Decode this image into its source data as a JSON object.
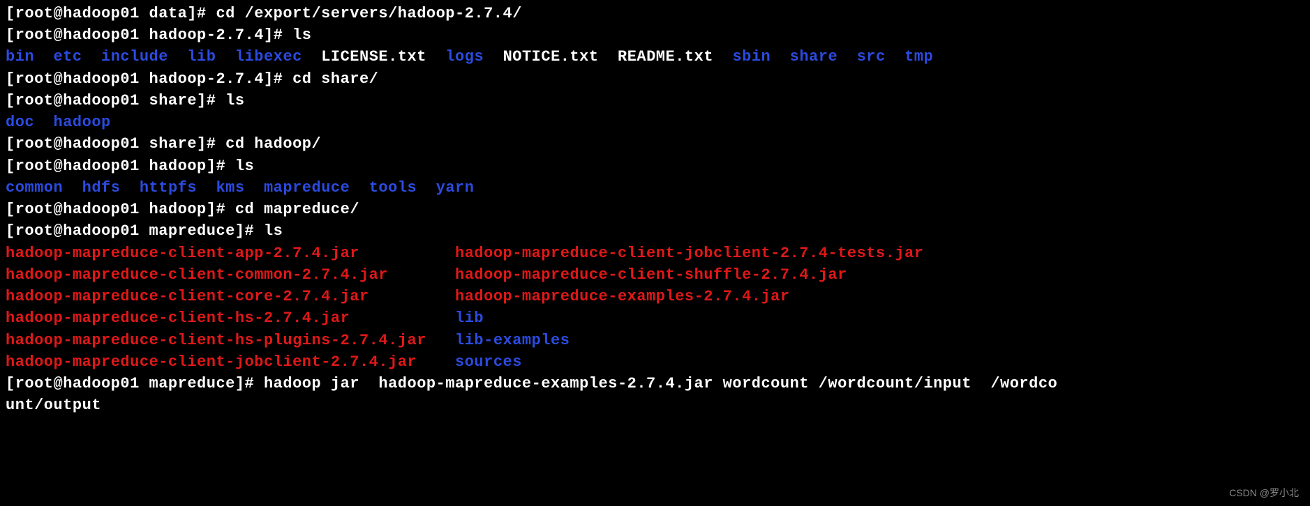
{
  "lines": [
    {
      "segments": [
        {
          "cls": "white",
          "text": "[root@hadoop01 data]# cd /export/servers/hadoop-2.7.4/"
        }
      ]
    },
    {
      "segments": [
        {
          "cls": "white",
          "text": "[root@hadoop01 hadoop-2.7.4]# ls"
        }
      ]
    },
    {
      "segments": [
        {
          "cls": "blue",
          "text": "bin"
        },
        {
          "cls": "white",
          "text": "  "
        },
        {
          "cls": "blue",
          "text": "etc"
        },
        {
          "cls": "white",
          "text": "  "
        },
        {
          "cls": "blue",
          "text": "include"
        },
        {
          "cls": "white",
          "text": "  "
        },
        {
          "cls": "blue",
          "text": "lib"
        },
        {
          "cls": "white",
          "text": "  "
        },
        {
          "cls": "blue",
          "text": "libexec"
        },
        {
          "cls": "white",
          "text": "  "
        },
        {
          "cls": "white",
          "text": "LICENSE.txt"
        },
        {
          "cls": "white",
          "text": "  "
        },
        {
          "cls": "blue",
          "text": "logs"
        },
        {
          "cls": "white",
          "text": "  "
        },
        {
          "cls": "white",
          "text": "NOTICE.txt"
        },
        {
          "cls": "white",
          "text": "  "
        },
        {
          "cls": "white",
          "text": "README.txt"
        },
        {
          "cls": "white",
          "text": "  "
        },
        {
          "cls": "blue",
          "text": "sbin"
        },
        {
          "cls": "white",
          "text": "  "
        },
        {
          "cls": "blue",
          "text": "share"
        },
        {
          "cls": "white",
          "text": "  "
        },
        {
          "cls": "blue",
          "text": "src"
        },
        {
          "cls": "white",
          "text": "  "
        },
        {
          "cls": "blue",
          "text": "tmp"
        }
      ]
    },
    {
      "segments": [
        {
          "cls": "white",
          "text": "[root@hadoop01 hadoop-2.7.4]# cd share/"
        }
      ]
    },
    {
      "segments": [
        {
          "cls": "white",
          "text": "[root@hadoop01 share]# ls"
        }
      ]
    },
    {
      "segments": [
        {
          "cls": "blue",
          "text": "doc"
        },
        {
          "cls": "white",
          "text": "  "
        },
        {
          "cls": "blue",
          "text": "hadoop"
        }
      ]
    },
    {
      "segments": [
        {
          "cls": "white",
          "text": "[root@hadoop01 share]# cd hadoop/"
        }
      ]
    },
    {
      "segments": [
        {
          "cls": "white",
          "text": "[root@hadoop01 hadoop]# ls"
        }
      ]
    },
    {
      "segments": [
        {
          "cls": "blue",
          "text": "common"
        },
        {
          "cls": "white",
          "text": "  "
        },
        {
          "cls": "blue",
          "text": "hdfs"
        },
        {
          "cls": "white",
          "text": "  "
        },
        {
          "cls": "blue",
          "text": "httpfs"
        },
        {
          "cls": "white",
          "text": "  "
        },
        {
          "cls": "blue",
          "text": "kms"
        },
        {
          "cls": "white",
          "text": "  "
        },
        {
          "cls": "blue",
          "text": "mapreduce"
        },
        {
          "cls": "white",
          "text": "  "
        },
        {
          "cls": "blue",
          "text": "tools"
        },
        {
          "cls": "white",
          "text": "  "
        },
        {
          "cls": "blue",
          "text": "yarn"
        }
      ]
    },
    {
      "segments": [
        {
          "cls": "white",
          "text": "[root@hadoop01 hadoop]# cd mapreduce/"
        }
      ]
    },
    {
      "segments": [
        {
          "cls": "white",
          "text": "[root@hadoop01 mapreduce]# ls"
        }
      ]
    },
    {
      "segments": [
        {
          "cls": "red",
          "text": "hadoop-mapreduce-client-app-2.7.4.jar"
        },
        {
          "cls": "white",
          "text": "          "
        },
        {
          "cls": "red",
          "text": "hadoop-mapreduce-client-jobclient-2.7.4-tests.jar"
        }
      ]
    },
    {
      "segments": [
        {
          "cls": "red",
          "text": "hadoop-mapreduce-client-common-2.7.4.jar"
        },
        {
          "cls": "white",
          "text": "       "
        },
        {
          "cls": "red",
          "text": "hadoop-mapreduce-client-shuffle-2.7.4.jar"
        }
      ]
    },
    {
      "segments": [
        {
          "cls": "red",
          "text": "hadoop-mapreduce-client-core-2.7.4.jar"
        },
        {
          "cls": "white",
          "text": "         "
        },
        {
          "cls": "red",
          "text": "hadoop-mapreduce-examples-2.7.4.jar"
        }
      ]
    },
    {
      "segments": [
        {
          "cls": "red",
          "text": "hadoop-mapreduce-client-hs-2.7.4.jar"
        },
        {
          "cls": "white",
          "text": "           "
        },
        {
          "cls": "blue",
          "text": "lib"
        }
      ]
    },
    {
      "segments": [
        {
          "cls": "red",
          "text": "hadoop-mapreduce-client-hs-plugins-2.7.4.jar"
        },
        {
          "cls": "white",
          "text": "   "
        },
        {
          "cls": "blue",
          "text": "lib-examples"
        }
      ]
    },
    {
      "segments": [
        {
          "cls": "red",
          "text": "hadoop-mapreduce-client-jobclient-2.7.4.jar"
        },
        {
          "cls": "white",
          "text": "    "
        },
        {
          "cls": "blue",
          "text": "sources"
        }
      ]
    },
    {
      "segments": [
        {
          "cls": "white",
          "text": "[root@hadoop01 mapreduce]# hadoop jar  hadoop-mapreduce-examples-2.7.4.jar wordcount /wordcount/input  /wordco"
        }
      ]
    },
    {
      "segments": [
        {
          "cls": "white",
          "text": "unt/output"
        }
      ]
    }
  ],
  "watermark": "CSDN @罗小北"
}
